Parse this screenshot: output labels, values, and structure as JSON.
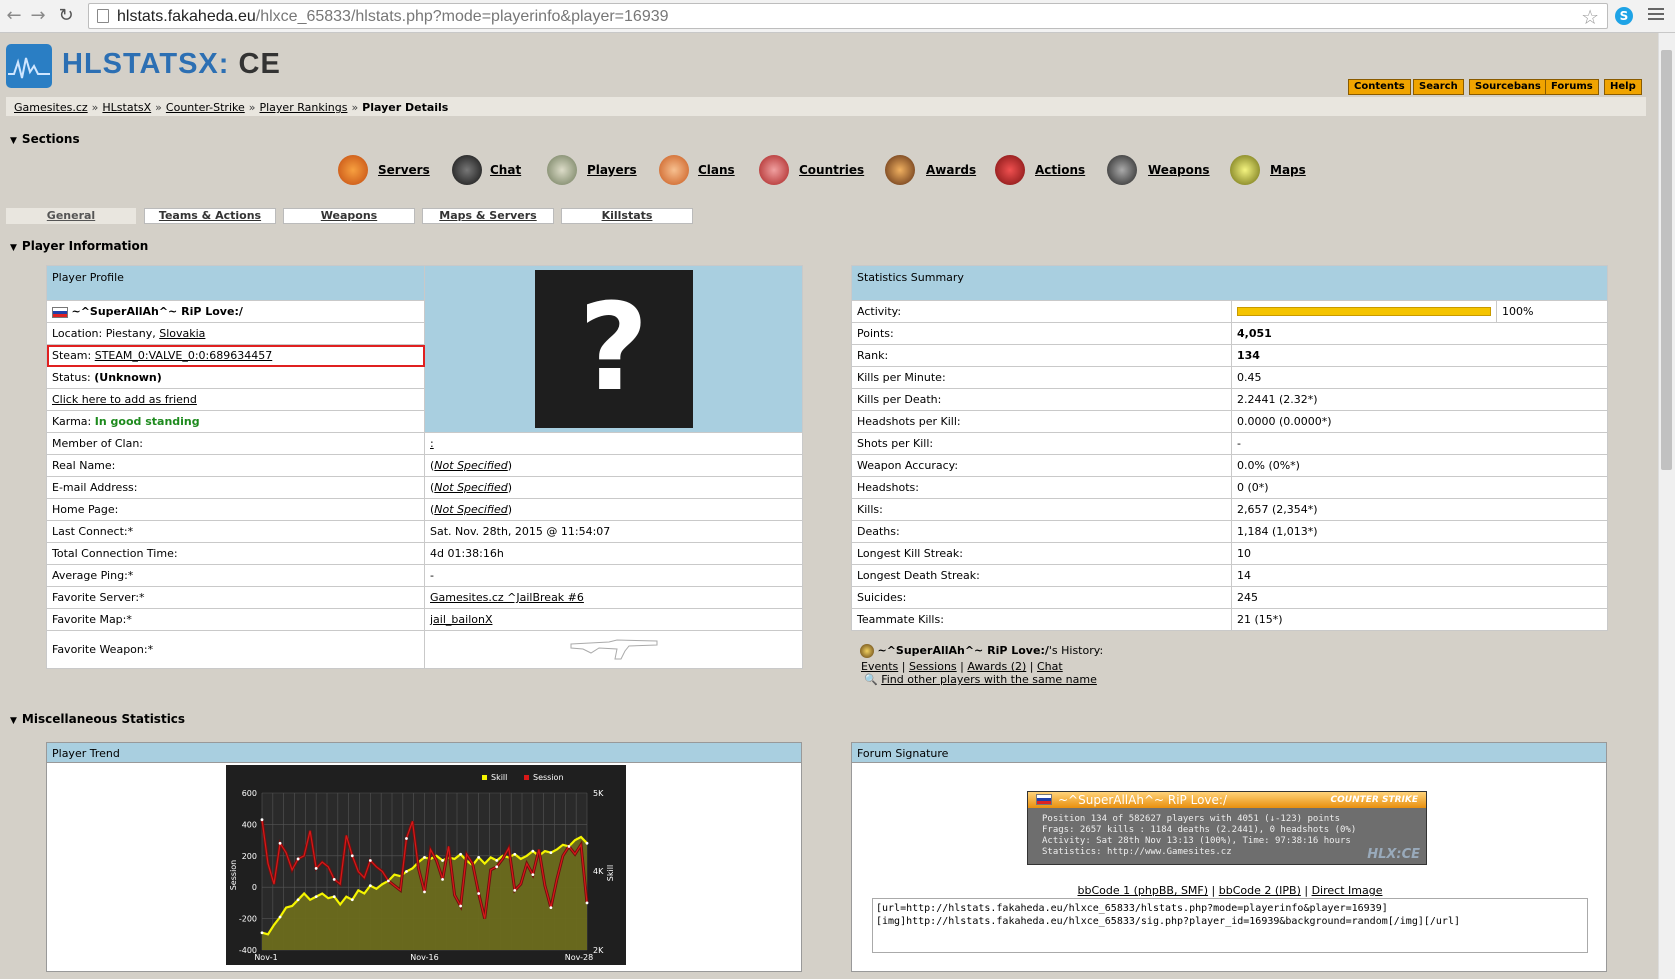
{
  "browser": {
    "url_host": "hlstats.fakaheda.eu",
    "url_path": "/hlxce_65833/hlstats.php?mode=playerinfo&player=16939"
  },
  "header": {
    "logo_main": "HLSTATSX",
    "logo_sep": ":",
    "logo_ce": "CE",
    "buttons": [
      "Contents",
      "Search",
      "Sourcebans",
      "Forums",
      "Help"
    ]
  },
  "breadcrumb": {
    "items": [
      "Gamesites.cz",
      "HLstatsX",
      "Counter-Strike",
      "Player Rankings"
    ],
    "current": "Player Details"
  },
  "sections": {
    "title": "Sections",
    "items": [
      "Servers",
      "Chat",
      "Players",
      "Clans",
      "Countries",
      "Awards",
      "Actions",
      "Weapons",
      "Maps"
    ]
  },
  "tabs": [
    "General",
    "Teams & Actions",
    "Weapons",
    "Maps & Servers",
    "Killstats"
  ],
  "player_info": {
    "title": "Player Information"
  },
  "profile": {
    "header": "Player Profile",
    "name": "~^SuperAllAh^~ RiP Love:/",
    "location_label": "Location:",
    "location_city": "Piestany,",
    "location_country": "Slovakia",
    "steam_label": "Steam:",
    "steam_id": "STEAM_0:VALVE_0:0:689634457",
    "status_label": "Status:",
    "status_value": "(Unknown)",
    "friend_link": "Click here to add as friend",
    "karma_label": "Karma:",
    "karma_value": "In good standing",
    "avatar_placeholder": "?",
    "rows": [
      {
        "label": "Member of Clan:",
        "value": ":",
        "link": true
      },
      {
        "label": "Real Name:",
        "value": "Not Specified",
        "ns": true
      },
      {
        "label": "E-mail Address:",
        "value": "Not Specified",
        "ns": true
      },
      {
        "label": "Home Page:",
        "value": "Not Specified",
        "ns": true
      },
      {
        "label": "Last Connect:*",
        "value": "Sat. Nov. 28th, 2015 @ 11:54:07"
      },
      {
        "label": "Total Connection Time:",
        "value": "4d 01:38:16h"
      },
      {
        "label": "Average Ping:*",
        "value": "-"
      },
      {
        "label": "Favorite Server:*",
        "value": "Gamesites.cz ^JailBreak #6",
        "link": true
      },
      {
        "label": "Favorite Map:*",
        "value": "jail_bailonX",
        "link": true
      },
      {
        "label": "Favorite Weapon:*",
        "value": ""
      }
    ]
  },
  "stats": {
    "header": "Statistics Summary",
    "activity_label": "Activity:",
    "activity_pct": "100%",
    "activity_fraction": 1.0,
    "rows": [
      {
        "label": "Points:",
        "value": "4,051",
        "bold": true
      },
      {
        "label": "Rank:",
        "value": "134",
        "bold": true
      },
      {
        "label": "Kills per Minute:",
        "value": "0.45"
      },
      {
        "label": "Kills per Death:",
        "value": "2.2441 (2.32*)"
      },
      {
        "label": "Headshots per Kill:",
        "value": "0.0000 (0.0000*)"
      },
      {
        "label": "Shots per Kill:",
        "value": "-"
      },
      {
        "label": "Weapon Accuracy:",
        "value": "0.0% (0%*)"
      },
      {
        "label": "Headshots:",
        "value": "0 (0*)"
      },
      {
        "label": "Kills:",
        "value": "2,657 (2,354*)"
      },
      {
        "label": "Deaths:",
        "value": "1,184 (1,013*)"
      },
      {
        "label": "Longest Kill Streak:",
        "value": "10"
      },
      {
        "label": "Longest Death Streak:",
        "value": "14"
      },
      {
        "label": "Suicides:",
        "value": "245"
      },
      {
        "label": "Teammate Kills:",
        "value": "21 (15*)"
      }
    ]
  },
  "history": {
    "title": "~^SuperAllAh^~ RiP Love:/",
    "suffix": "'s History:",
    "links": [
      "Events",
      "Sessions",
      "Awards (2)",
      "Chat"
    ],
    "find": "Find other players with the same name"
  },
  "misc": {
    "title": "Miscellaneous Statistics"
  },
  "trend": {
    "header": "Player Trend"
  },
  "chart_data": {
    "type": "line",
    "x_ticks": [
      "Nov-1",
      "Nov-16",
      "Nov-28"
    ],
    "y_left_ticks": [
      "600",
      "400",
      "200",
      "0",
      "-200",
      "-400"
    ],
    "y_right_ticks": [
      "5K",
      "4K",
      "2K"
    ],
    "y_left_label": "Session",
    "y_right_label": "Skill",
    "ylim_left": [
      -400,
      600
    ],
    "series": [
      {
        "name": "Skill",
        "color": "#f5f500",
        "values": [
          -290,
          -300,
          -240,
          -190,
          -130,
          -120,
          -80,
          -40,
          -80,
          -60,
          -40,
          -70,
          -60,
          -110,
          -60,
          -80,
          -20,
          -40,
          10,
          -10,
          20,
          40,
          80,
          70,
          100,
          120,
          160,
          190,
          180,
          200,
          170,
          190,
          180,
          210,
          170,
          140,
          190,
          150,
          190,
          170,
          200,
          190,
          210,
          180,
          200,
          230,
          200,
          230,
          220,
          240,
          270,
          260,
          300,
          320,
          280
        ]
      },
      {
        "name": "Session",
        "color": "#d81818",
        "values": [
          430,
          150,
          20,
          280,
          220,
          110,
          180,
          200,
          360,
          120,
          160,
          130,
          50,
          20,
          330,
          200,
          100,
          60,
          170,
          130,
          100,
          40,
          10,
          -20,
          310,
          420,
          120,
          -30,
          240,
          170,
          50,
          260,
          -50,
          -120,
          210,
          150,
          -40,
          -200,
          110,
          130,
          180,
          250,
          -20,
          20,
          150,
          80,
          240,
          10,
          -130,
          50,
          200,
          260,
          210,
          270,
          -100
        ]
      }
    ]
  },
  "signature": {
    "header": "Forum Signature",
    "img_name": "~^SuperAllAh^~ RiP Love:/",
    "img_brand": "COUNTER STRIKE",
    "img_lines": [
      "Position 134 of 582627 players with 4051 (↓-123) points",
      "Frags: 2657 kills : 1184 deaths (2.2441), 0 headshots (0%)",
      "Activity: Sat 28th Nov 13:13 (100%), Time: 97:38:16 hours",
      "Statistics: http://www.Gamesites.cz"
    ],
    "img_mark": "HLX:CE",
    "links": [
      "bbCode 1 (phpBB, SMF)",
      "bbCode 2 (IPB)",
      "Direct Image"
    ],
    "code": "[url=http://hlstats.fakaheda.eu/hlxce_65833/hlstats.php?mode=playerinfo&player=16939]\n[img]http://hlstats.fakaheda.eu/hlxce_65833/sig.php?player_id=16939&background=random[/img][/url]"
  },
  "colors": {
    "header_blue": "#a9cfe0",
    "activity_bar": "#f5c400",
    "highlight": "#e02020",
    "button": "#f0a400"
  }
}
